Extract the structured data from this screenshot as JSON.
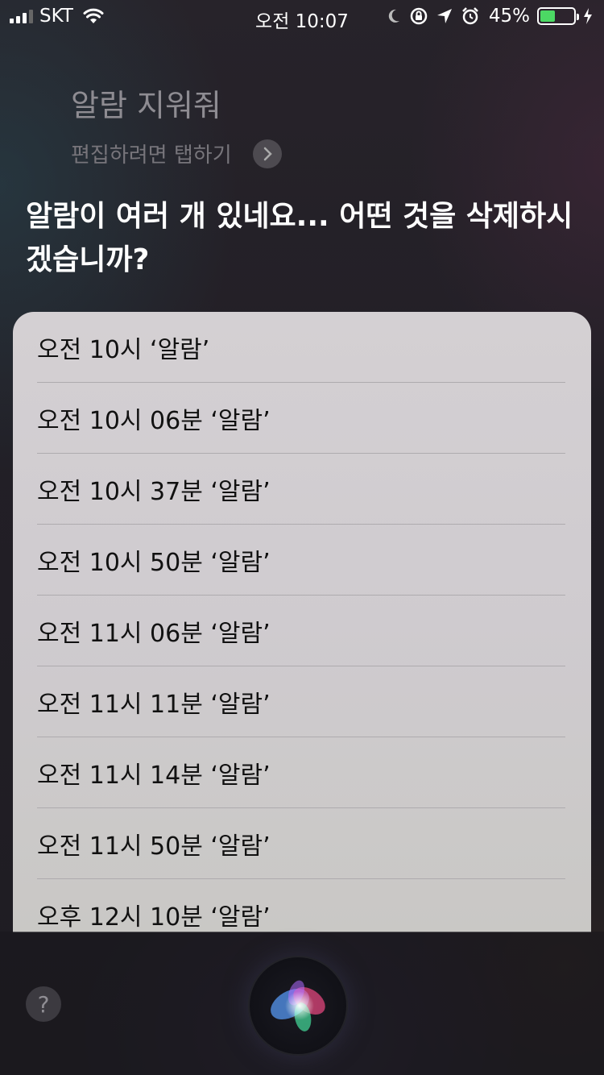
{
  "status_bar": {
    "carrier": "SKT",
    "time": "오전 10:07",
    "battery_percent": "45%",
    "battery_level": 0.45
  },
  "siri": {
    "query": "알람 지워줘",
    "edit_hint": "편집하려면 탭하기",
    "response": "알람이 여러 개 있네요... 어떤 것을 삭제하시겠습니까?"
  },
  "alarms": [
    {
      "label": "오전 10시 ‘알람’"
    },
    {
      "label": "오전 10시 06분 ‘알람’"
    },
    {
      "label": "오전 10시 37분 ‘알람’"
    },
    {
      "label": "오전 10시 50분 ‘알람’"
    },
    {
      "label": "오전 11시 06분 ‘알람’"
    },
    {
      "label": "오전 11시 11분 ‘알람’"
    },
    {
      "label": "오전 11시 14분 ‘알람’"
    },
    {
      "label": "오전 11시 50분 ‘알람’"
    },
    {
      "label": "오후 12시 10분 ‘알람’"
    }
  ],
  "bottom_bar": {
    "help_label": "?"
  },
  "colors": {
    "battery_fill": "#4cd964",
    "card_bg": "#d0ccd0"
  }
}
